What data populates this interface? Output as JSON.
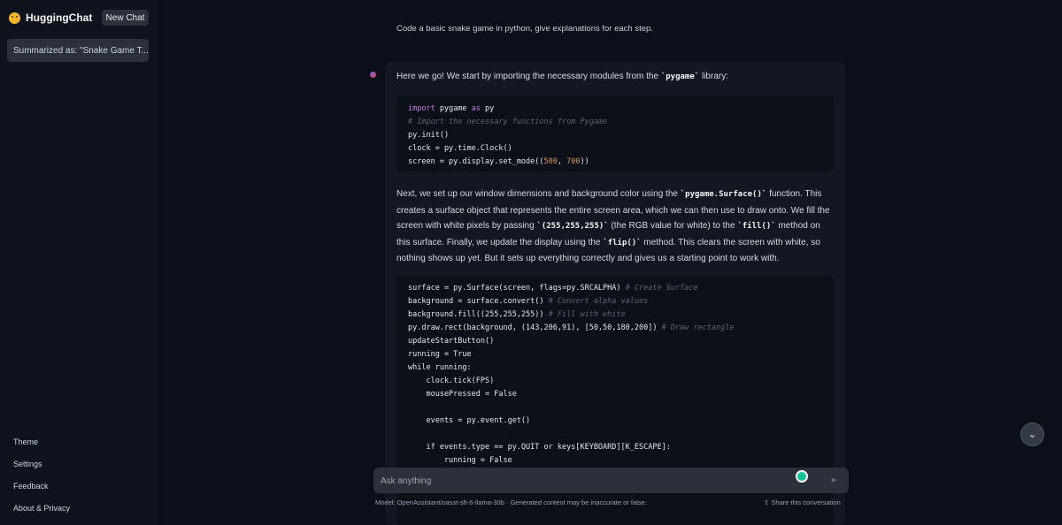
{
  "app": {
    "brand_name": "HuggingChat",
    "new_chat_label": "New Chat",
    "brand_icon": "smiley-face-icon"
  },
  "sidebar": {
    "conversations": [
      {
        "label": "Summarized as: \"Snake Game T..."
      }
    ],
    "links": [
      {
        "label": "Theme"
      },
      {
        "label": "Settings"
      },
      {
        "label": "Feedback"
      },
      {
        "label": "About & Privacy"
      }
    ]
  },
  "chat": {
    "user_message": "Code a basic snake game in python, give explanations for each step.",
    "assistant": {
      "intro_before": "Here we go! We start by importing the necessary modules from the ",
      "intro_code": "`pygame`",
      "intro_after": " library:",
      "para2": {
        "t1": "Next, we set up our window dimensions and background color using the ",
        "c1": "`pygame.Surface()`",
        "t2": " function. This creates a surface object that represents the entire screen area, which we can then use to draw onto. We fill the screen with white pixels by passing ",
        "c2": "`(255,255,255)`",
        "t3": " (the RGB value for white) to the ",
        "c3": "`fill()`",
        "t4": " method on this surface. Finally, we update the display using the ",
        "c4": "`flip()`",
        "t5": " method. This clears the screen with white, so nothing shows up yet. But it sets up everything correctly and gives us a starting point to work with."
      },
      "code1": {
        "l1_kw": "import",
        "l1_rest": " pygame ",
        "l1_kw2": "as",
        "l1_rest2": " py",
        "l2": "# Import the necessary functions from Pygame",
        "l3": "py.init()",
        "l4": "clock = py.time.Clock()",
        "l5_a": "screen = py.display.set_mode((",
        "l5_n1": "500",
        "l5_b": ", ",
        "l5_n2": "700",
        "l5_c": "))"
      },
      "code2": {
        "l1": "surface = py.Surface(screen, flags=py.SRCALPHA) ",
        "l1c": "# Create Surface",
        "l2": "background = surface.convert() ",
        "l2c": "# Convert alpha values",
        "l3": "background.fill((255,255,255)) ",
        "l3c": "# Fill with white",
        "l4": "py.draw.rect(background, (143,206,91), [50,50,180,200]) ",
        "l4c": "# Draw rectangle",
        "l5": "updateStartButton()",
        "l6": "running = True",
        "l7": "while running:",
        "l8": "    clock.tick(FPS)",
        "l9": "    mousePressed = False",
        "l10": "    events = py.event.get()",
        "l11": "    if events.type == py.QUIT or keys[KEYBOARD][K_ESCAPE]:",
        "l12": "        running = False"
      }
    }
  },
  "composer": {
    "placeholder": "Ask anything",
    "footer_note": "Model: OpenAssistant/oasst-sft-6-llama-30b · Generated content may be inaccurate or false.",
    "share_label": "Share this conversation"
  }
}
